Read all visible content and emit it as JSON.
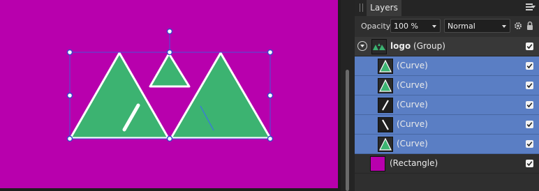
{
  "colors": {
    "artboard_bg": "#b800ad",
    "shape_fill": "#3cb371",
    "selection_blue": "#4a55d6",
    "layer_selected": "#5a7ec4"
  },
  "panel": {
    "tab_label": "Layers",
    "opacity_label": "Opacity:",
    "opacity_value": "100 %",
    "blend_mode": "Normal"
  },
  "layers": {
    "group": {
      "name": "logo",
      "type": "(Group)",
      "visible": true,
      "expanded": true
    },
    "children": [
      {
        "label": "(Curve)",
        "thumb": "triangle",
        "selected": true,
        "visible": true
      },
      {
        "label": "(Curve)",
        "thumb": "triangle",
        "selected": true,
        "visible": true
      },
      {
        "label": "(Curve)",
        "thumb": "slash-forward",
        "selected": true,
        "visible": true
      },
      {
        "label": "(Curve)",
        "thumb": "slash-back",
        "selected": true,
        "visible": true
      },
      {
        "label": "(Curve)",
        "thumb": "triangle",
        "selected": true,
        "visible": true
      }
    ],
    "rectangle": {
      "label": "(Rectangle)",
      "visible": true
    }
  }
}
